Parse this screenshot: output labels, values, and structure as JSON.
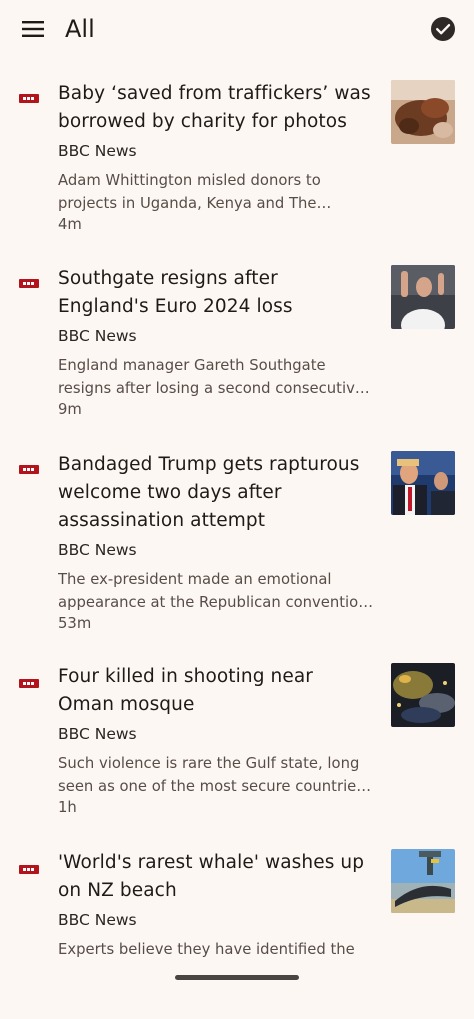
{
  "header": {
    "title": "All",
    "menu_icon": "hamburger-menu-icon",
    "mark_read_icon": "check-circle-icon"
  },
  "colors": {
    "background": "#fdf7f3",
    "bbc_red": "#b3141b",
    "text_primary": "#1f1a18",
    "text_secondary": "#574d48"
  },
  "articles": [
    {
      "headline": "Baby ‘saved from traffickers’ was borrowed by charity for photos",
      "source": "BBC News",
      "summary": "Adam Whittington misled donors to projects in Uganda, Kenya and The Gambia, the BBC has found.",
      "age": "4m"
    },
    {
      "headline": "Southgate resigns after England's Euro 2024 loss",
      "source": "BBC News",
      "summary": "England manager Gareth Southgate resigns after losing a second consecutive Euros final.",
      "age": "9m"
    },
    {
      "headline": "Bandaged Trump gets rapturous welcome two days after assassination attempt",
      "source": "BBC News",
      "summary": "The ex-president made an emotional appearance at the Republican convention in Milwaukee.",
      "age": "53m"
    },
    {
      "headline": "Four killed in shooting near Oman mosque",
      "source": "BBC News",
      "summary": "Such violence is rare the Gulf state, long seen as one of the most secure countries in the region.",
      "age": "1h"
    },
    {
      "headline": "'World's rarest whale' washes up on NZ beach",
      "source": "BBC News",
      "summary": "Experts believe they have identified the",
      "age": ""
    }
  ]
}
